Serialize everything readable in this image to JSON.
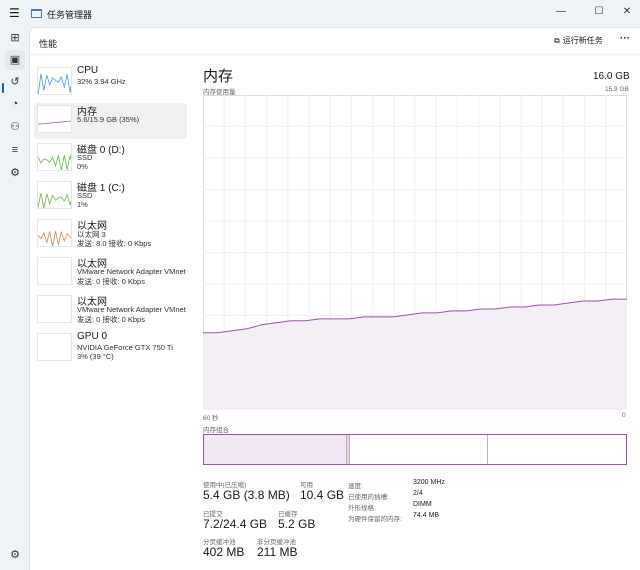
{
  "window": {
    "title": "任务管理器",
    "minimize": "—",
    "maximize": "☐",
    "close": "✕"
  },
  "header": {
    "title": "性能",
    "run_new_task": "运行新任务",
    "more": "···"
  },
  "sidebar": [
    {
      "name": "CPU",
      "sub1": "32%  3.94 GHz",
      "sub2": ""
    },
    {
      "name": "内存",
      "sub1": "5.6/15.9 GB (35%)",
      "sub2": ""
    },
    {
      "name": "磁盘 0 (D:)",
      "sub1": "SSD",
      "sub2": "0%"
    },
    {
      "name": "磁盘 1 (C:)",
      "sub1": "SSD",
      "sub2": "1%"
    },
    {
      "name": "以太网",
      "sub1": "以太网 3",
      "sub2": "发送: 8.0  接收: 0 Kbps"
    },
    {
      "name": "以太网",
      "sub1": "VMware Network Adapter VMnet",
      "sub2": "发送: 0  接收: 0 Kbps"
    },
    {
      "name": "以太网",
      "sub1": "VMware Network Adapter VMnet",
      "sub2": "发送: 0  接收: 0 Kbps"
    },
    {
      "name": "GPU 0",
      "sub1": "NVIDIA GeForce GTX 750 Ti",
      "sub2": "3% (39 °C)"
    }
  ],
  "main": {
    "title": "内存",
    "total": "16.0 GB",
    "usage_label": "内存使用量",
    "usage_max": "15.9 GB",
    "x_left": "60 秒",
    "x_right": "0",
    "composition_label": "内存组合",
    "composition": {
      "in_use": 5.4,
      "modified": 0.1,
      "standby": 5.2,
      "free": 5.2
    },
    "stats": {
      "in_use_label": "使用中(已压缩)",
      "in_use": "5.4 GB (3.8 MB)",
      "available_label": "可用",
      "available": "10.4 GB",
      "committed_label": "已提交",
      "committed": "7.2/24.4 GB",
      "cached_label": "已缓存",
      "cached": "5.2 GB",
      "paged_label": "分页缓冲池",
      "paged": "402 MB",
      "nonpaged_label": "非分页缓冲池",
      "nonpaged": "211 MB"
    },
    "specs": [
      {
        "k": "速度:",
        "v": "3200 MHz"
      },
      {
        "k": "已使用的插槽:",
        "v": "2/4"
      },
      {
        "k": "外形规格:",
        "v": "DIMM"
      },
      {
        "k": "为硬件保留的内存:",
        "v": "74.4 MB"
      }
    ]
  },
  "colors": {
    "accent": "#9b4fb0",
    "fill": "#f4eff5"
  },
  "chart_data": {
    "type": "area",
    "ylim": [
      0,
      15.9
    ],
    "xlim": [
      60,
      0
    ],
    "values": [
      3.9,
      3.9,
      4.0,
      4.1,
      4.3,
      4.4,
      4.5,
      4.5,
      4.6,
      4.6,
      4.6,
      4.7,
      4.7,
      4.7,
      4.8,
      4.9,
      4.9,
      5.0,
      5.0,
      5.1,
      5.1,
      5.2,
      5.2,
      5.3,
      5.3,
      5.4,
      5.5,
      5.5,
      5.6,
      5.6
    ]
  }
}
